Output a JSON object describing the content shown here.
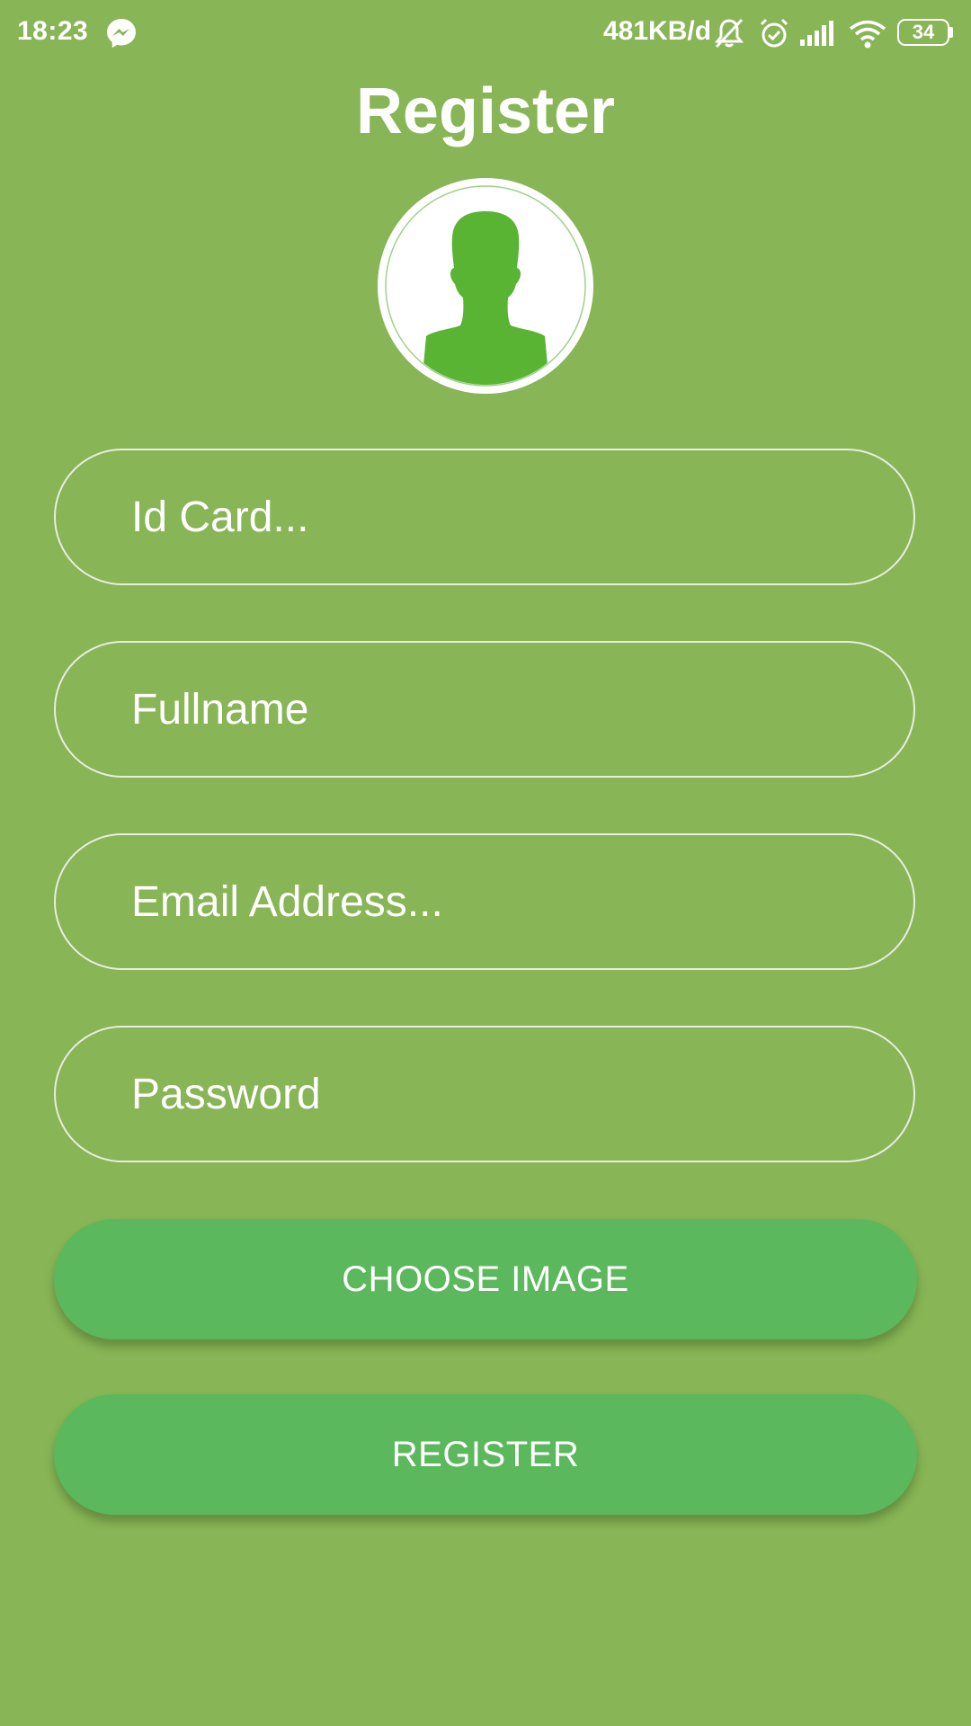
{
  "status_bar": {
    "time": "18:23",
    "net_speed": "481KB/d",
    "battery": "34",
    "icons": [
      "messenger-icon",
      "muted-bell-icon",
      "alarm-icon",
      "signal-icon",
      "wifi-icon",
      "battery-icon"
    ]
  },
  "title": "Register",
  "avatar": {
    "icon": "person-silhouette-icon"
  },
  "form": {
    "id_card_placeholder": "Id Card...",
    "fullname_placeholder": "Fullname",
    "email_placeholder": "Email Address...",
    "password_placeholder": "Password",
    "choose_image_label": "CHOOSE IMAGE",
    "register_label": "REGISTER"
  },
  "colors": {
    "background": "#88b556",
    "button": "#5cb85c",
    "avatar_silhouette": "#5ab433",
    "text": "#ffffff"
  }
}
